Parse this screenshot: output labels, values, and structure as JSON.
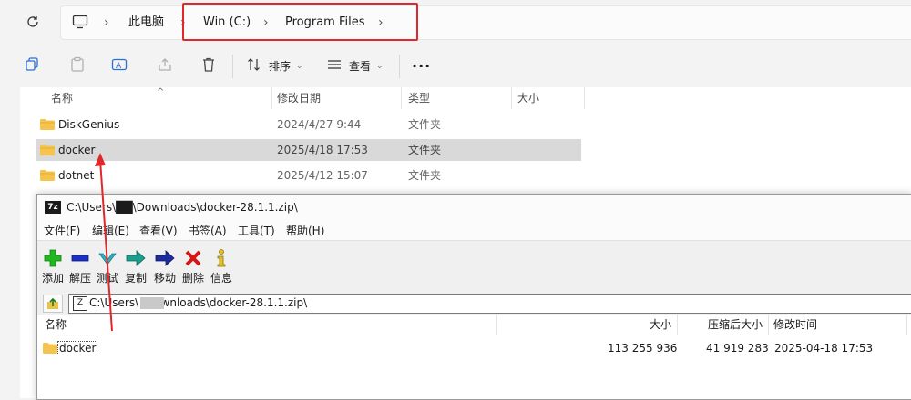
{
  "breadcrumb": {
    "items": [
      "此电脑",
      "Win (C:)",
      "Program Files"
    ]
  },
  "toolbar": {
    "sort_label": "排序",
    "view_label": "查看",
    "more_label": "···"
  },
  "columns": {
    "name": "名称",
    "modified": "修改日期",
    "type": "类型",
    "size": "大小"
  },
  "files": [
    {
      "name": "DiskGenius",
      "modified": "2024/4/27 9:44",
      "type": "文件夹",
      "size": ""
    },
    {
      "name": "docker",
      "modified": "2025/4/18 17:53",
      "type": "文件夹",
      "size": ""
    },
    {
      "name": "dotnet",
      "modified": "2025/4/12 15:07",
      "type": "文件夹",
      "size": ""
    }
  ],
  "zip": {
    "title": "C:\\Users\\██\\Downloads\\docker-28.1.1.zip\\",
    "logo": "7z",
    "menu": [
      "文件(F)",
      "编辑(E)",
      "查看(V)",
      "书签(A)",
      "工具(T)",
      "帮助(H)"
    ],
    "tools": [
      "添加",
      "解压",
      "测试",
      "复制",
      "移动",
      "删除",
      "信息"
    ],
    "path": "C:\\Users\\    \\Downloads\\docker-28.1.1.zip\\",
    "columns": {
      "name": "名称",
      "size": "大小",
      "packed": "压缩后大小",
      "modified": "修改时间"
    },
    "rows": [
      {
        "name": "docker",
        "size": "113 255 936",
        "packed": "41 919 283",
        "modified": "2025-04-18 17:53"
      }
    ]
  },
  "colors": {
    "highlight_red": "#e0282a",
    "folder_yellow": "#f4c44e",
    "selection_gray": "#d9d9d9"
  }
}
